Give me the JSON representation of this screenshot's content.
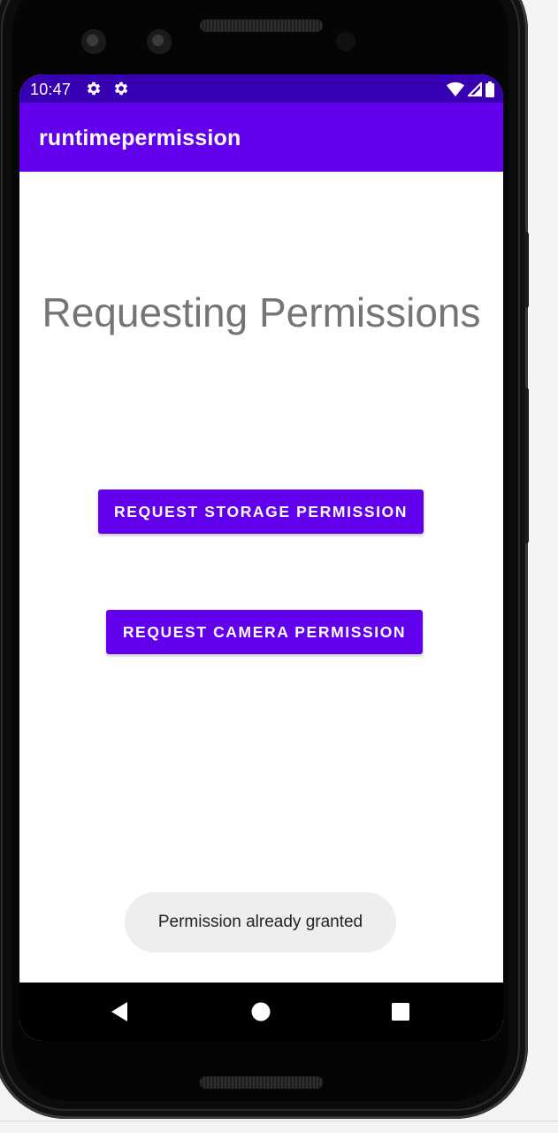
{
  "status_bar": {
    "time": "10:47",
    "background": "#3700b3",
    "left_icons": [
      "settings-gear-icon",
      "settings-gear-icon"
    ],
    "right_icons": [
      "wifi-icon",
      "cell-signal-icon",
      "battery-icon"
    ]
  },
  "app_bar": {
    "title": "runtimepermission",
    "background": "#6200ee"
  },
  "main": {
    "heading": "Requesting Permissions",
    "heading_color": "#757575",
    "buttons": [
      {
        "label": "REQUEST STORAGE PERMISSION"
      },
      {
        "label": "REQUEST CAMERA PERMISSION"
      }
    ],
    "button_color": "#6200ee"
  },
  "toast": {
    "message": "Permission already granted"
  },
  "nav_bar": {
    "buttons": [
      "back-icon",
      "home-icon",
      "recents-icon"
    ]
  }
}
